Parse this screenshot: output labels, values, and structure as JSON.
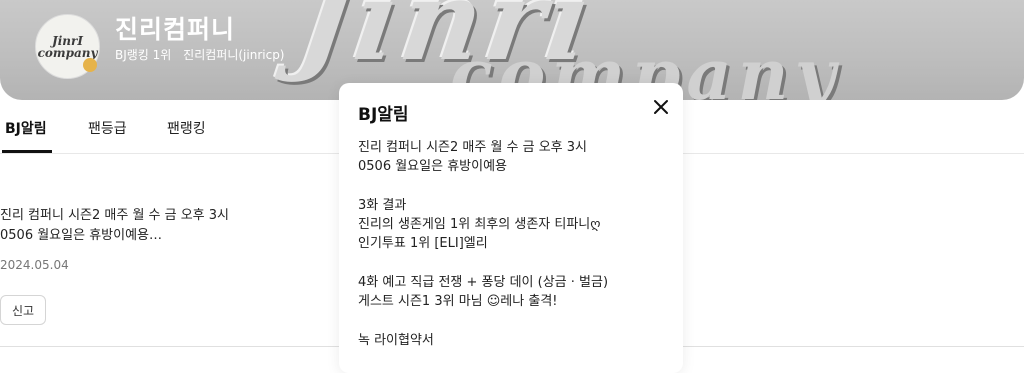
{
  "channel": {
    "name": "진리컴퍼니",
    "rank": "BJ랭킹 1위",
    "handle": "진리컴퍼니(jinricp)",
    "avatar_text": [
      "JinrI",
      "company"
    ]
  },
  "tabs": [
    {
      "label": "BJ알림",
      "active": true
    },
    {
      "label": "팬등급",
      "active": false
    },
    {
      "label": "팬랭킹",
      "active": false
    }
  ],
  "post": {
    "preview": "진리 컴퍼니 시즌2 매주 월 수 금 오후 3시\n0506 월요일은 휴방이예용…",
    "date": "2024.05.04",
    "report_label": "신고"
  },
  "modal": {
    "title": "BJ알림",
    "lines": [
      "진리 컴퍼니 시즌2 매주 월 수 금 오후 3시",
      "0506 월요일은 휴방이예용",
      "",
      "3화 결과",
      "진리의 생존게임 1위 최후의 생존자 티파니ღ",
      "인기투표 1위 [ELI]엘리",
      "",
      "4화 예고 직급 전쟁 + 퐁당 데이 (상금 · 벌금)",
      "게스트 시즌1 3위 마님 ☺레나 출격!",
      "",
      "녹 라이협약서"
    ]
  },
  "colors": {
    "banner": "#c2c2c2",
    "text": "#222222",
    "muted": "#777777",
    "tab_underline": "#111111"
  },
  "icons": {
    "close": "close-icon"
  }
}
